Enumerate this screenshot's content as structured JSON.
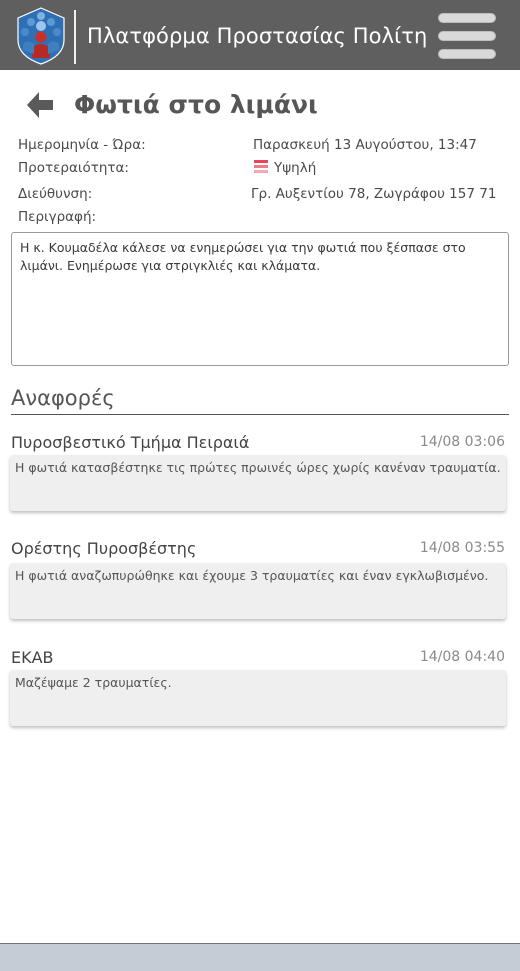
{
  "header": {
    "app_title": "Πλατφόρμα Προστασίας Πολίτη",
    "logo_icon": "citizens-shield-logo-icon",
    "menu_icon": "hamburger-menu-icon"
  },
  "page": {
    "title": "Φωτιά στο λιμάνι",
    "back_icon": "back-arrow-icon"
  },
  "details": {
    "datetime_label": "Ημερομηνία - Ώρα:",
    "datetime_value": "Παρασκευή 13 Αυγούστου, 13:47",
    "priority_label": "Προτεραιότητα:",
    "priority_value": "Υψηλή",
    "priority_color": "#e8455a",
    "address_label": "Διεύθυνση:",
    "address_value": "Γρ. Αυξεντίου 78, Ζωγράφου 157 71",
    "description_label": "Περιγραφή:",
    "description_value": "Η κ. Κουμαδέλα κάλεσε να ενημερώσει για την φωτιά που ξέσπασε στο λιμάνι. Ενημέρωσε για στριγκλιές και κλάματα."
  },
  "reports_section": {
    "title": "Αναφορές",
    "items": [
      {
        "author": "Πυροσβεστικό Τμήμα Πειραιά",
        "time": "14/08 03:06",
        "text": "Η φωτιά κατασβέστηκε τις πρώτες πρωινές ώρες χωρίς κανέναν τραυματία."
      },
      {
        "author": "Ορέστης Πυροσβέστης",
        "time": "14/08 03:55",
        "text": "Η φωτιά αναζωπυρώθηκε και έχουμε 3 τραυματίες και έναν εγκλωβισμένο."
      },
      {
        "author": "ΕΚΑΒ",
        "time": "14/08 04:40",
        "text": "Μαζέψαμε 2 τραυματίες."
      }
    ]
  }
}
